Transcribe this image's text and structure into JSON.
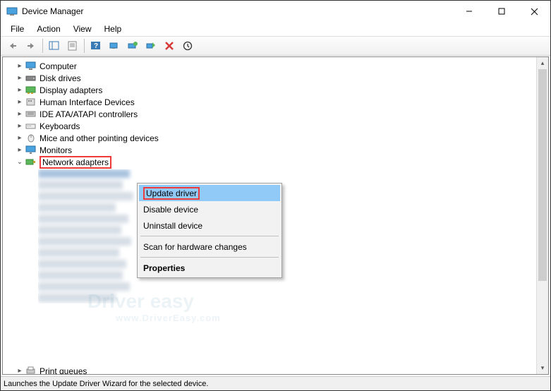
{
  "titlebar": {
    "title": "Device Manager"
  },
  "menubar": {
    "file": "File",
    "action": "Action",
    "view": "View",
    "help": "Help"
  },
  "tree": {
    "items": [
      {
        "label": "Computer",
        "expand": "▸"
      },
      {
        "label": "Disk drives",
        "expand": "▸"
      },
      {
        "label": "Display adapters",
        "expand": "▸"
      },
      {
        "label": "Human Interface Devices",
        "expand": "▸"
      },
      {
        "label": "IDE ATA/ATAPI controllers",
        "expand": "▸"
      },
      {
        "label": "Keyboards",
        "expand": "▸"
      },
      {
        "label": "Mice and other pointing devices",
        "expand": "▸"
      },
      {
        "label": "Monitors",
        "expand": "▸"
      },
      {
        "label": "Network adapters",
        "expand": "⌄",
        "highlighted": true,
        "expanded": true
      },
      {
        "label": "Print queues",
        "expand": "▸"
      }
    ]
  },
  "context_menu": {
    "update": "Update driver",
    "disable": "Disable device",
    "uninstall": "Uninstall device",
    "scan": "Scan for hardware changes",
    "properties": "Properties"
  },
  "statusbar": {
    "text": "Launches the Update Driver Wizard for the selected device."
  },
  "watermark": {
    "brand": "Driver easy",
    "url": "www.DriverEasy.com"
  }
}
